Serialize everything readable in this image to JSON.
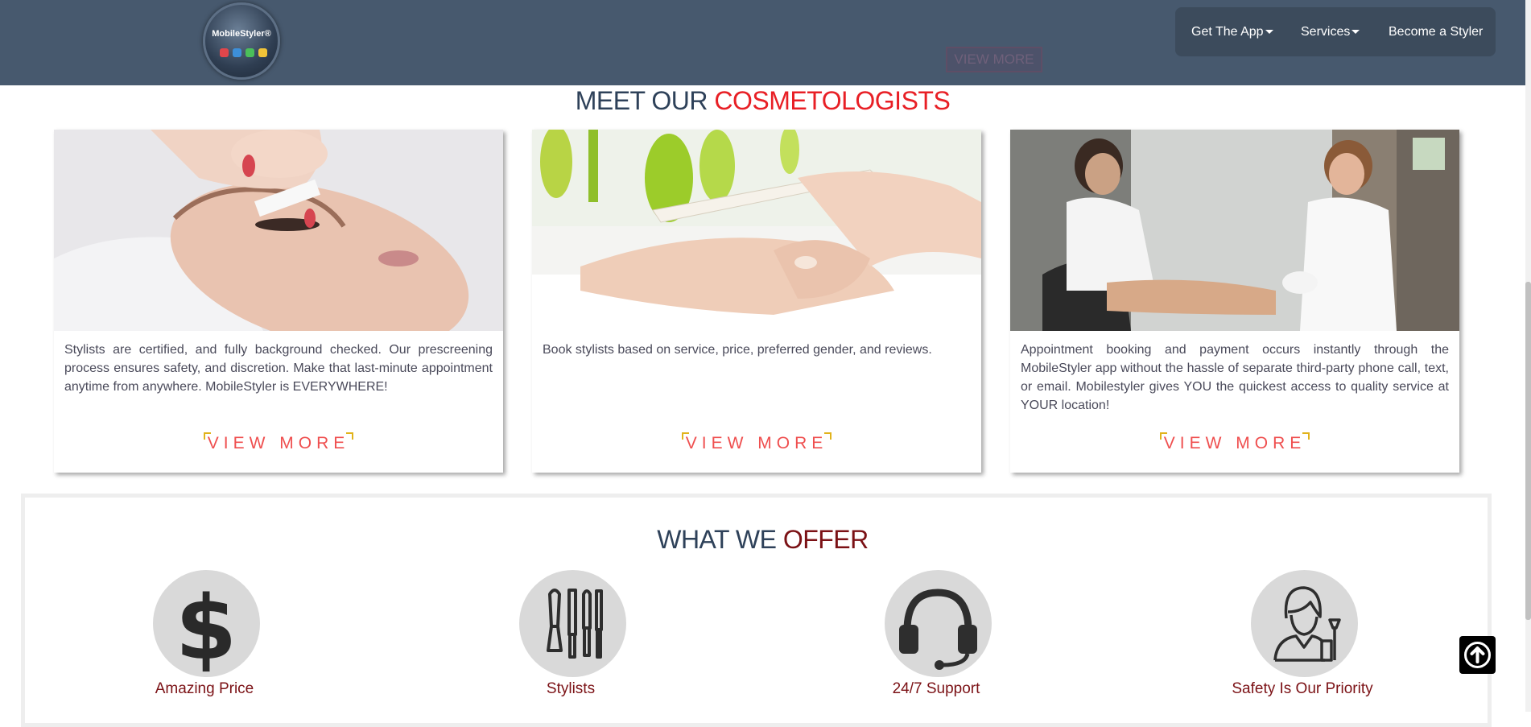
{
  "header": {
    "logo_text": "MobileStyler®",
    "ghost_button": "VIEW MORE",
    "nav": {
      "get_app": "Get The App",
      "services": "Services",
      "become_styler": "Become a Styler"
    }
  },
  "cosmetologists": {
    "title_part1": "MEET OUR",
    "title_part2": "COSMETOLOGISTS",
    "cards": [
      {
        "image": "facial-waxing-photo",
        "text": "Stylists are certified, and fully background checked. Our prescreening process ensures safety, and discretion. Make that last-minute appointment anytime from anywhere. MobileStyler is EVERYWHERE!",
        "button": "VIEW MORE"
      },
      {
        "image": "nail-filing-photo",
        "text": "Book stylists based on service, price, preferred gender, and reviews.",
        "button": "VIEW MORE"
      },
      {
        "image": "pedicure-photo",
        "text": "Appointment booking and payment occurs instantly through the MobileStyler app without the hassle of separate third-party phone call, text, or email. Mobilestyler gives YOU the quickest access to quality service at YOUR location!",
        "button": "VIEW MORE"
      }
    ]
  },
  "offer": {
    "title_part1": "WHAT WE",
    "title_part2": "OFFER",
    "items": [
      {
        "icon": "dollar-icon",
        "label": "Amazing Price"
      },
      {
        "icon": "brushes-icon",
        "label": "Stylists"
      },
      {
        "icon": "headset-icon",
        "label": "24/7 Support"
      },
      {
        "icon": "stylist-person-icon",
        "label": "Safety Is Our Priority"
      }
    ]
  },
  "colors": {
    "header_bg": "#47596e",
    "title_dark": "#2e4159",
    "title_red": "#e81f25",
    "title_maroon": "#7b1115",
    "view_more_text": "#ef4f4f",
    "view_more_bracket": "#e1b31b"
  }
}
